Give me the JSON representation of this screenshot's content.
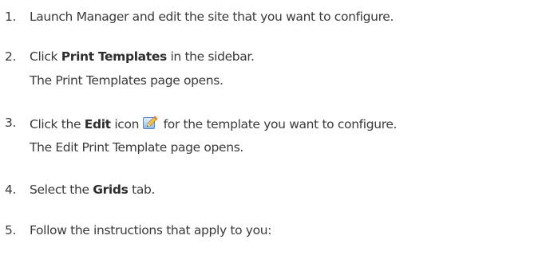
{
  "steps": [
    {
      "number": "1.",
      "text": "Launch Manager and edit the site that you want to configure."
    },
    {
      "number": "2.",
      "before": "Click ",
      "bold": "Print Templates",
      "after": " in the sidebar.",
      "result": "The Print Templates page opens."
    },
    {
      "number": "3.",
      "before": "Click the ",
      "bold": "Edit",
      "middle": " icon",
      "icon": "edit-icon",
      "after": " for the template you want to configure.",
      "result": "The Edit Print Template page opens."
    },
    {
      "number": "4.",
      "before": "Select the ",
      "bold": "Grids",
      "after": " tab."
    },
    {
      "number": "5.",
      "text": "Follow the instructions that apply to you:"
    }
  ]
}
